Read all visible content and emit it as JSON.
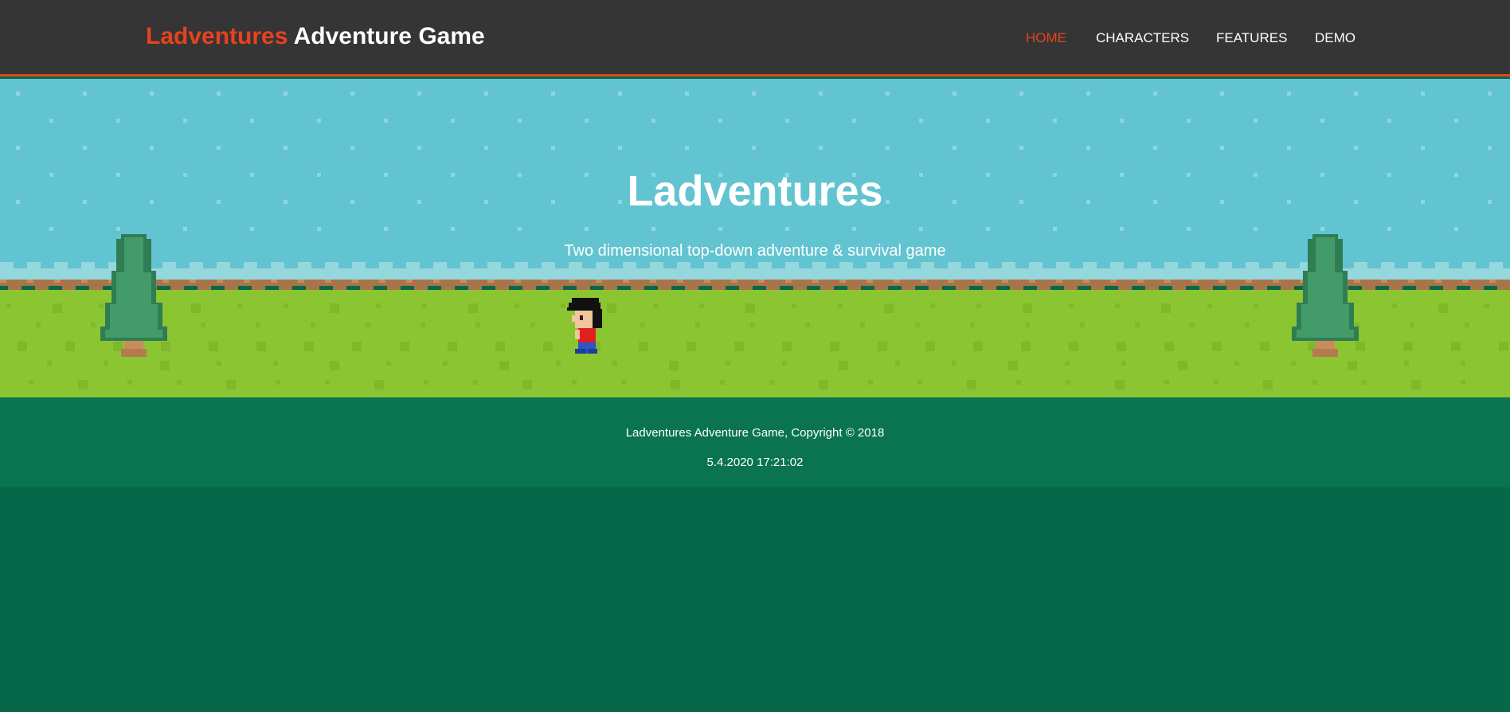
{
  "header": {
    "logo_accent": "Ladventures",
    "logo_rest": "Adventure Game",
    "nav": [
      {
        "label": "HOME",
        "active": true
      },
      {
        "label": "CHARACTERS",
        "active": false
      },
      {
        "label": "FEATURES",
        "active": false
      },
      {
        "label": "DEMO",
        "active": false
      }
    ]
  },
  "hero": {
    "title": "Ladventures",
    "subtitle": "Two dimensional top-down adventure & survival game",
    "background": {
      "sky": "#62c4d0",
      "grass": "#8bc532",
      "dirt": "#a8744a",
      "tree": "#449b6a",
      "tree_trunk": "#b57b50"
    },
    "character": "pixel-boy-character"
  },
  "footer": {
    "copyright": "Ladventures Adventure Game, Copyright © 2018",
    "timestamp": "5.4.2020 17:21:02"
  },
  "colors": {
    "accent": "#e9411f",
    "header_bg": "#353535",
    "footer_bg": "#0a7450",
    "page_bg": "#076849"
  }
}
